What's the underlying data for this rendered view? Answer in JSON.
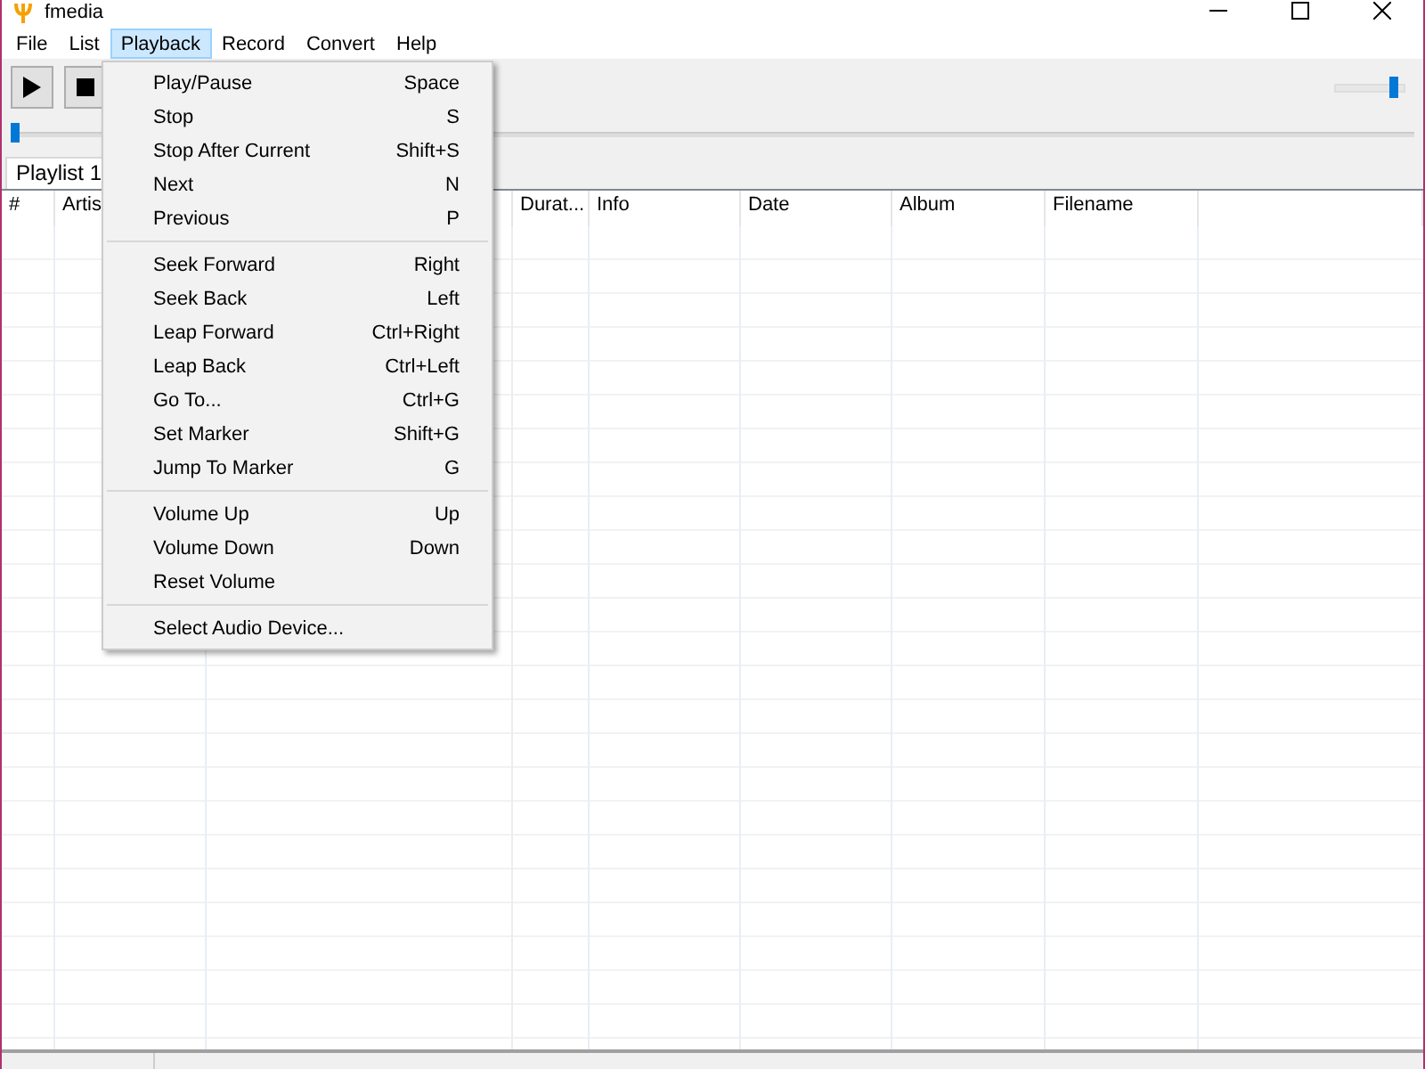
{
  "window": {
    "title": "fmedia"
  },
  "menu_bar": [
    {
      "label": "File",
      "selected": false
    },
    {
      "label": "List",
      "selected": false
    },
    {
      "label": "Playback",
      "selected": true
    },
    {
      "label": "Record",
      "selected": false
    },
    {
      "label": "Convert",
      "selected": false
    },
    {
      "label": "Help",
      "selected": false
    }
  ],
  "toolbar": {
    "volume": {
      "level": 0.88
    },
    "seek": {
      "level": 0.0
    }
  },
  "tabs": [
    {
      "label": "Playlist 1",
      "selected": true
    }
  ],
  "table": {
    "columns": [
      "#",
      "Artis",
      "",
      "Durat...",
      "Info",
      "Date",
      "Album",
      "Filename",
      ""
    ]
  },
  "playback_menu": [
    {
      "kind": "item",
      "label": "Play/Pause",
      "shortcut": "Space"
    },
    {
      "kind": "item",
      "label": "Stop",
      "shortcut": "S"
    },
    {
      "kind": "item",
      "label": "Stop After Current",
      "shortcut": "Shift+S"
    },
    {
      "kind": "item",
      "label": "Next",
      "shortcut": "N"
    },
    {
      "kind": "item",
      "label": "Previous",
      "shortcut": "P"
    },
    {
      "kind": "separator"
    },
    {
      "kind": "item",
      "label": "Seek Forward",
      "shortcut": "Right"
    },
    {
      "kind": "item",
      "label": "Seek Back",
      "shortcut": "Left"
    },
    {
      "kind": "item",
      "label": "Leap Forward",
      "shortcut": "Ctrl+Right"
    },
    {
      "kind": "item",
      "label": "Leap Back",
      "shortcut": "Ctrl+Left"
    },
    {
      "kind": "item",
      "label": "Go To...",
      "shortcut": "Ctrl+G"
    },
    {
      "kind": "item",
      "label": "Set Marker",
      "shortcut": "Shift+G"
    },
    {
      "kind": "item",
      "label": "Jump To Marker",
      "shortcut": "G"
    },
    {
      "kind": "separator"
    },
    {
      "kind": "item",
      "label": "Volume Up",
      "shortcut": "Up"
    },
    {
      "kind": "item",
      "label": "Volume Down",
      "shortcut": "Down"
    },
    {
      "kind": "item",
      "label": "Reset Volume"
    },
    {
      "kind": "separator"
    },
    {
      "kind": "item",
      "label": "Select Audio Device..."
    }
  ]
}
